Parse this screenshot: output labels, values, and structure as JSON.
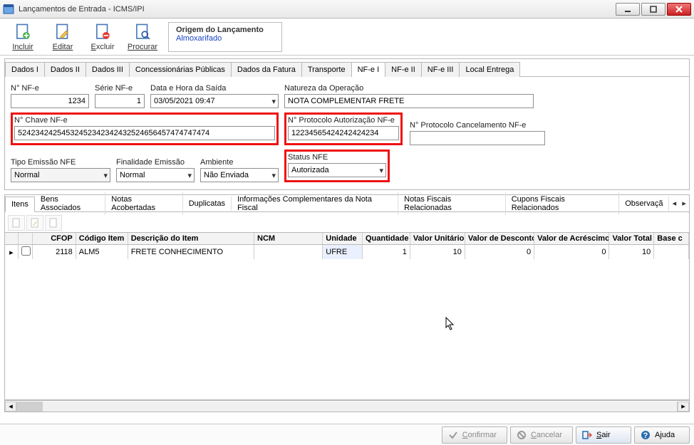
{
  "window": {
    "title": "Lançamentos de Entrada - ICMS/IPI"
  },
  "toolbar": {
    "incluir": "Incluir",
    "editar": "Editar",
    "excluir": "Excluir",
    "procurar": "Procurar",
    "origin_label": "Origem do Lançamento",
    "origin_value": "Almoxarifado"
  },
  "outer_tabs": [
    "Dados I",
    "Dados II",
    "Dados III",
    "Concessionárias Públicas",
    "Dados da Fatura",
    "Transporte",
    "NF-e I",
    "NF-e II",
    "NF-e III",
    "Local Entrega"
  ],
  "outer_tabs_active": 6,
  "form": {
    "n_nfe_label": "N° NF-e",
    "n_nfe_value": "1234",
    "serie_label": "Série NF-e",
    "serie_value": "1",
    "data_saida_label": "Data e Hora da Saída",
    "data_saida_value": "03/05/2021 09:47",
    "natureza_label": "Natureza da Operação",
    "natureza_value": "NOTA COMPLEMENTAR FRETE",
    "chave_label": "N° Chave NF-e",
    "chave_value": "52423424254532452342342432524656457474747474",
    "proto_aut_label": "N° Protocolo Autorização NF-e",
    "proto_aut_value": "12234565424242424234",
    "proto_canc_label": "N° Protocolo Cancelamento NF-e",
    "proto_canc_value": "",
    "tipo_emissao_label": "Tipo Emissão NFE",
    "tipo_emissao_value": "Normal",
    "finalidade_label": "Finalidade Emissão",
    "finalidade_value": "Normal",
    "ambiente_label": "Ambiente",
    "ambiente_value": "Não Enviada",
    "status_label": "Status NFE",
    "status_value": "Autorizada"
  },
  "sub_tabs": [
    "Itens",
    "Bens Associados",
    "Notas Acobertadas",
    "Duplicatas",
    "Informações Complementares da Nota Fiscal",
    "Notas Fiscais Relacionadas",
    "Cupons Fiscais Relacionados",
    "Observaçã"
  ],
  "sub_tabs_active": 0,
  "grid": {
    "headers": [
      "",
      "",
      "CFOP",
      "Código Item",
      "Descrição do Item",
      "NCM",
      "Unidade",
      "Quantidade",
      "Valor Unitário",
      "Valor de Desconto",
      "Valor de Acréscimo",
      "Valor Total",
      "Base c"
    ],
    "row": {
      "cfop": "2118",
      "codigo": "ALM5",
      "descricao": "FRETE CONHECIMENTO",
      "ncm": "",
      "unidade": "UFRE",
      "quantidade": "1",
      "valor_unitario": "10",
      "valor_desconto": "0",
      "valor_acrescimo": "0",
      "valor_total": "10",
      "base_c": ""
    }
  },
  "footer": {
    "confirmar": "Confirmar",
    "cancelar": "Cancelar",
    "sair": "Sair",
    "ajuda": "Ajuda"
  }
}
